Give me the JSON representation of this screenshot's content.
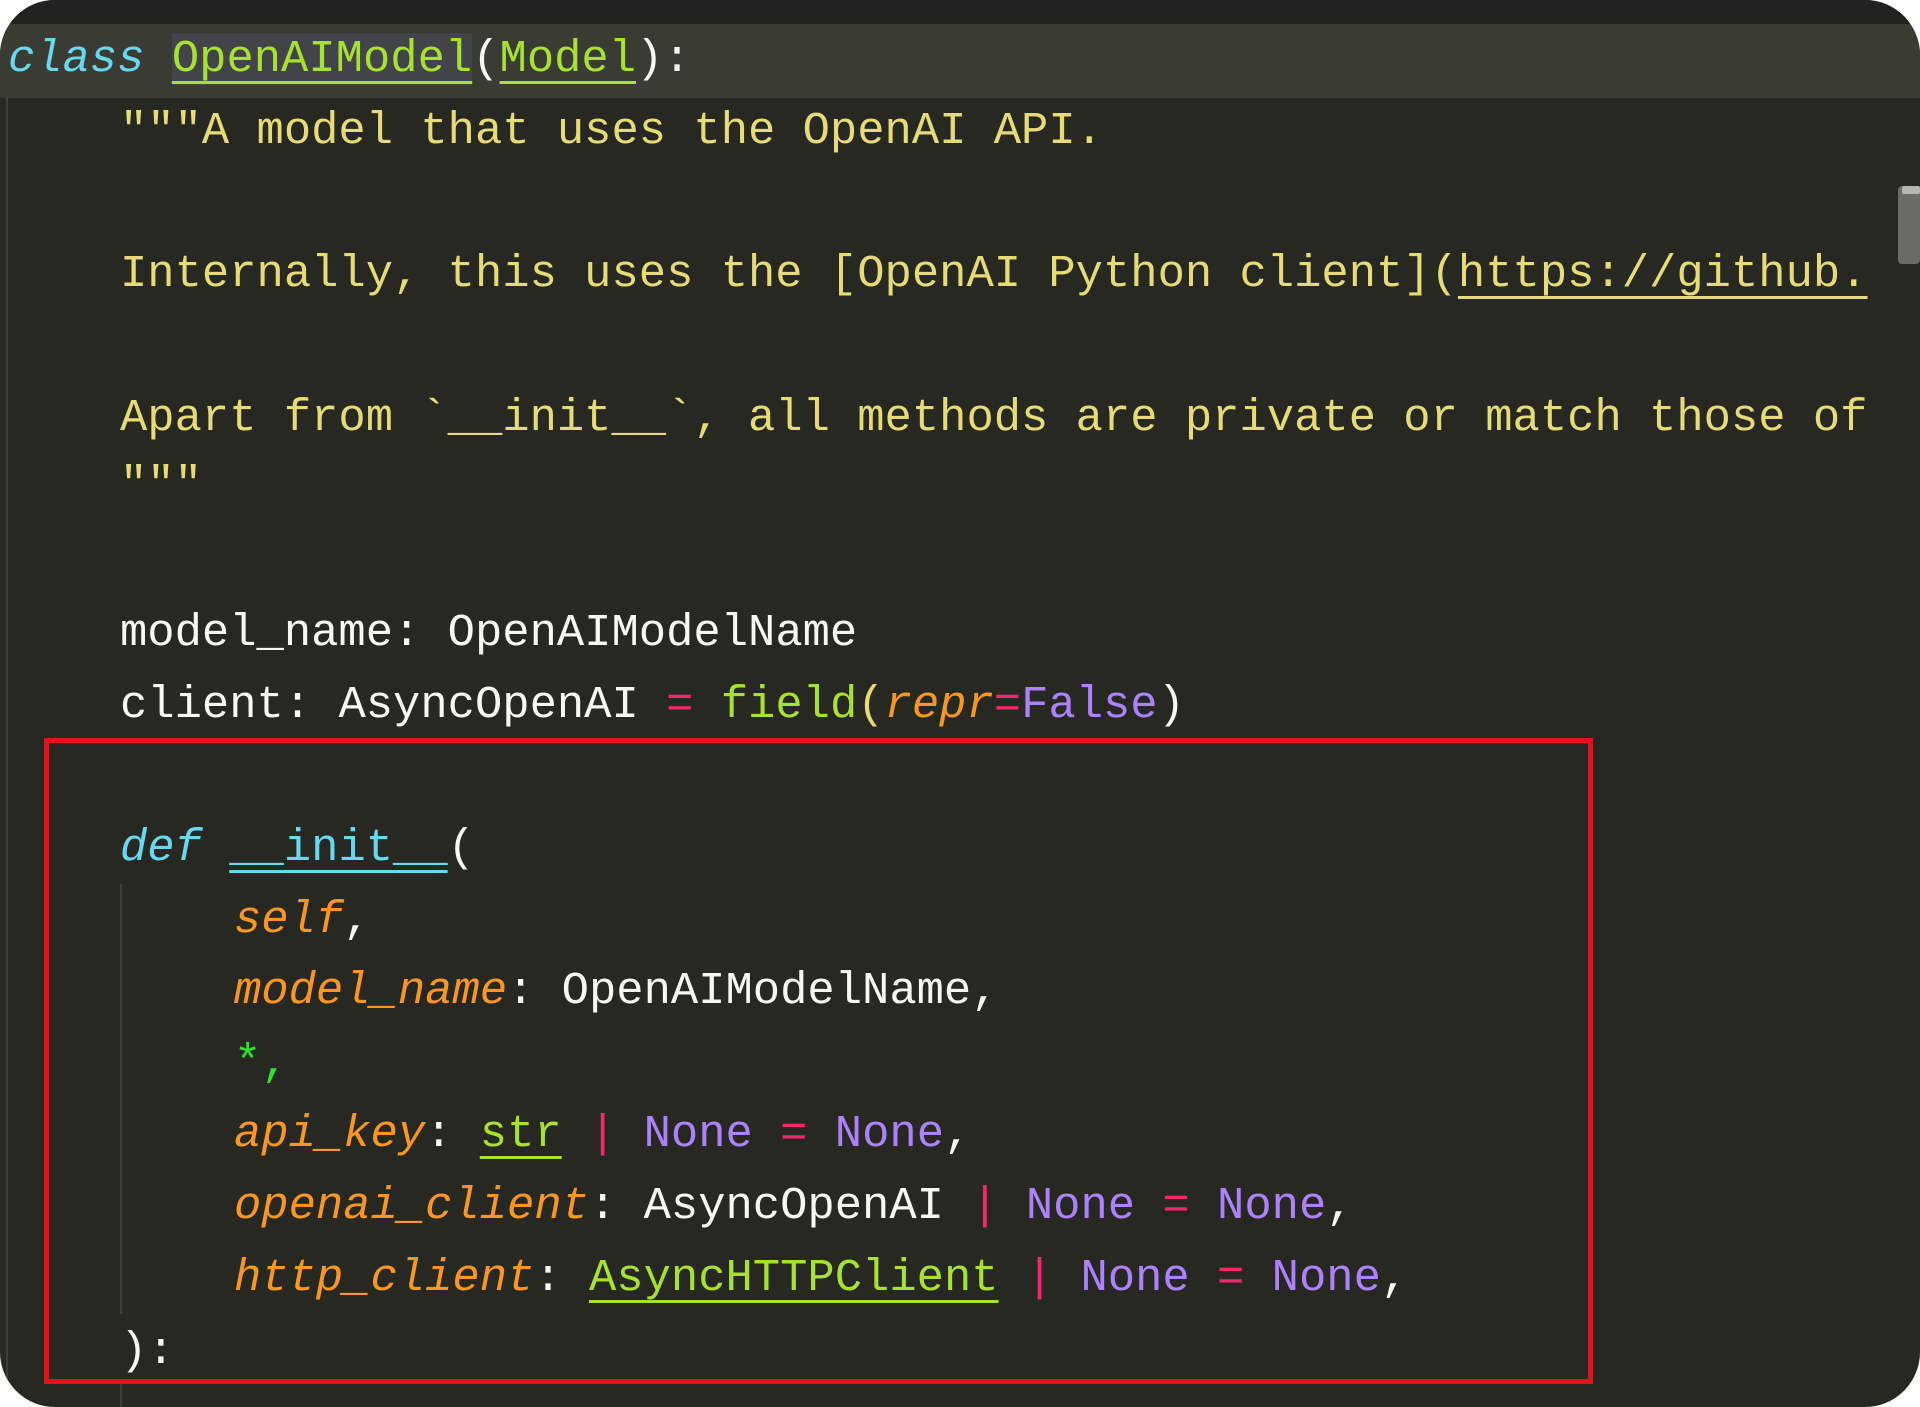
{
  "code": {
    "class_line": {
      "keyword": "class",
      "class_name": "OpenAIModel",
      "open_paren": "(",
      "base_class": "Model",
      "close": "):"
    },
    "docstring": {
      "line1": "\"\"\"A model that uses the OpenAI API.",
      "line3_text": "Internally, this uses the [OpenAI Python client](",
      "line3_link": "https://github.",
      "line5": "Apart from `__init__`, all methods are private or match those of",
      "line6": "\"\"\""
    },
    "fields": {
      "model_name": {
        "name": "model_name:",
        "type": " OpenAIModelName"
      },
      "client": {
        "name": "client:",
        "type": " AsyncOpenAI ",
        "equals": "=",
        "func": " field",
        "open": "(",
        "kwarg": "repr",
        "kwarg_eq": "=",
        "value": "False",
        "close": ")"
      }
    },
    "init": {
      "keyword": "def",
      "name": "__init__",
      "open": "(",
      "params": {
        "self": "self",
        "self_comma": ",",
        "model_name": "model_name",
        "model_name_sep": ":",
        "model_name_type": " OpenAIModelName,",
        "star": "*",
        "star_comma": ",",
        "api_key": "api_key",
        "api_key_sep": ":",
        "api_key_type": "str",
        "pipe": "|",
        "none_type": "None",
        "eq": "=",
        "none_default": "None",
        "trail_comma": ",",
        "openai_client": "openai_client",
        "openai_client_sep": ":",
        "openai_client_type": " AsyncOpenAI ",
        "http_client": "http_client",
        "http_client_sep": ":",
        "http_client_type": "AsyncHTTPClient"
      },
      "close": "):"
    }
  },
  "colors": {
    "background": "#272822",
    "current_line": "#3a3b33",
    "keyword": "#66d9ef",
    "class_name": "#a6e22e",
    "string": "#e6db74",
    "parameter": "#fd971f",
    "operator": "#f92672",
    "constant": "#ae81ff",
    "highlight_box": "#e8101a"
  }
}
